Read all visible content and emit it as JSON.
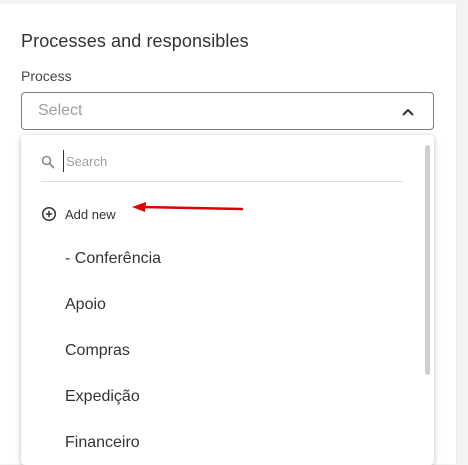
{
  "section": {
    "title": "Processes and responsibles"
  },
  "process_field": {
    "label": "Process",
    "placeholder": "Select",
    "chevron_icon": "chevron-up-icon"
  },
  "dropdown": {
    "search_placeholder": "Search",
    "search_icon": "search-icon",
    "add_new_label": "Add new",
    "add_new_icon": "plus-circle-icon",
    "options": [
      "- Conferência",
      "Apoio",
      "Compras",
      "Expedição",
      "Financeiro"
    ]
  },
  "annotation": {
    "arrow_color": "#e00000"
  }
}
